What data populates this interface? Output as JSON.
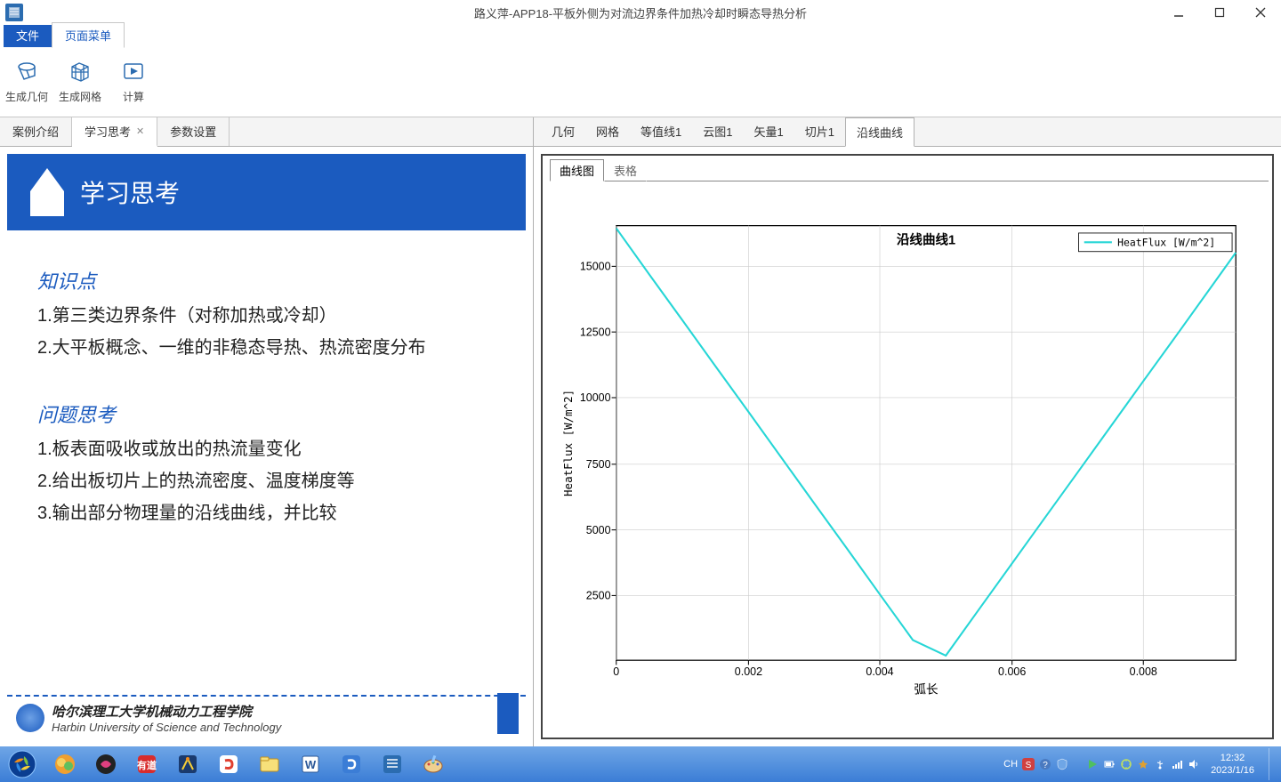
{
  "window": {
    "title": "路义萍-APP18-平板外侧为对流边界条件加热冷却时瞬态导热分析"
  },
  "menu": {
    "file": "文件",
    "page_menu": "页面菜单"
  },
  "ribbon": {
    "gen_geom": "生成几何",
    "gen_mesh": "生成网格",
    "compute": "计算"
  },
  "left_tabs": {
    "case_intro": "案例介绍",
    "study_think": "学习思考",
    "param_set": "参数设置"
  },
  "slide": {
    "header": "学习思考",
    "kp_title": "知识点",
    "kp1": "1.第三类边界条件（对称加热或冷却）",
    "kp2": "2.大平板概念、一维的非稳态导热、热流密度分布",
    "q_title": "问题思考",
    "q1": "1.板表面吸收或放出的热流量变化",
    "q2": "2.给出板切片上的热流密度、温度梯度等",
    "q3": "3.输出部分物理量的沿线曲线，并比较",
    "uni_cn": "哈尔滨理工大学机械动力工程学院",
    "uni_en": "Harbin University of Science and Technology"
  },
  "right_tabs": {
    "geometry": "几何",
    "mesh": "网格",
    "contour": "等值线1",
    "cloud": "云图1",
    "vector": "矢量1",
    "slice": "切片1",
    "line": "沿线曲线"
  },
  "chart": {
    "subtab_curve": "曲线图",
    "subtab_table": "表格",
    "title": "沿线曲线1",
    "legend": "HeatFlux [W/m^2]",
    "ylabel": "HeatFlux [W/m^2]",
    "xlabel": "弧长",
    "xticks": [
      "0",
      "0.002",
      "0.004",
      "0.006",
      "0.008"
    ],
    "yticks": [
      "2500",
      "5000",
      "7500",
      "10000",
      "12500",
      "15000"
    ]
  },
  "chart_data": {
    "type": "line",
    "title": "沿线曲线1",
    "xlabel": "弧长",
    "ylabel": "HeatFlux [W/m^2]",
    "series": [
      {
        "name": "HeatFlux [W/m^2]",
        "x": [
          0,
          0.0005,
          0.001,
          0.0015,
          0.002,
          0.0025,
          0.003,
          0.0035,
          0.004,
          0.0045,
          0.005,
          0.0055,
          0.006,
          0.0065,
          0.007,
          0.0075,
          0.008,
          0.0085,
          0.009,
          0.0094
        ],
        "y": [
          16400,
          14650,
          12920,
          11180,
          9450,
          7710,
          5970,
          4240,
          2500,
          770,
          180,
          1920,
          3660,
          5400,
          7130,
          8870,
          10610,
          12340,
          14080,
          15480
        ]
      }
    ],
    "xlim": [
      0,
      0.0094
    ],
    "ylim": [
      0,
      16500
    ]
  },
  "tray": {
    "lang": "CH",
    "time": "12:32",
    "date": "2023/1/16"
  }
}
